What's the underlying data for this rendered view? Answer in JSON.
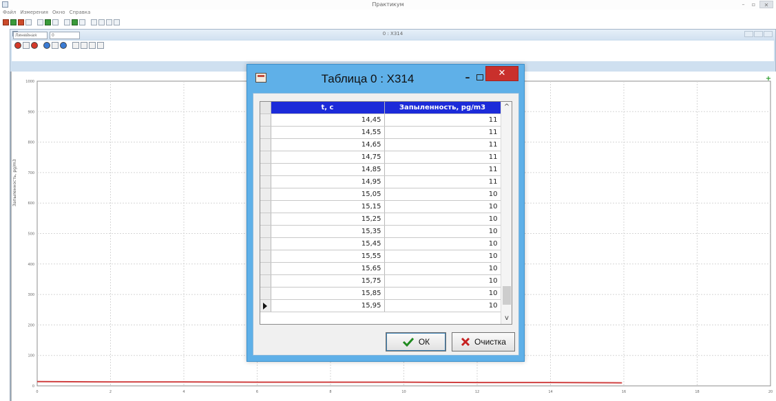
{
  "app": {
    "title": "Практикум",
    "menu": [
      "Файл",
      "Измерения",
      "Окно",
      "Справка"
    ],
    "window_controls": [
      "–",
      "▫",
      "✕"
    ]
  },
  "child_window": {
    "title": "0 : X314",
    "series_select_value": "Линейная",
    "series_input_value": "0"
  },
  "chart": {
    "ylabel": "Запыленность, pg/m3",
    "add_button": "+"
  },
  "chart_data": {
    "type": "line",
    "title": "",
    "xlabel": "",
    "ylabel": "Запыленность, pg/m3",
    "ylim": [
      0,
      1000
    ],
    "xlim": [
      0,
      20
    ],
    "y_ticks": [
      "0",
      "100",
      "200",
      "300",
      "400",
      "500",
      "600",
      "700",
      "800",
      "900",
      "1000"
    ],
    "x_ticks": [
      "0",
      "2",
      "4",
      "6",
      "8",
      "10",
      "12",
      "14",
      "16",
      "18",
      "20"
    ],
    "grid": true,
    "series": [
      {
        "x": [
          0,
          2,
          4,
          6,
          8,
          10,
          12,
          14,
          15.95
        ],
        "values": [
          14,
          13,
          13,
          12,
          12,
          12,
          11,
          11,
          10
        ],
        "color": "#d04040"
      }
    ]
  },
  "dialog": {
    "title": "Таблица 0 : X314",
    "columns": [
      "t, c",
      "Запыленность, pg/m3"
    ],
    "rows": [
      [
        "14,45",
        "11"
      ],
      [
        "14,55",
        "11"
      ],
      [
        "14,65",
        "11"
      ],
      [
        "14,75",
        "11"
      ],
      [
        "14,85",
        "11"
      ],
      [
        "14,95",
        "11"
      ],
      [
        "15,05",
        "10"
      ],
      [
        "15,15",
        "10"
      ],
      [
        "15,25",
        "10"
      ],
      [
        "15,35",
        "10"
      ],
      [
        "15,45",
        "10"
      ],
      [
        "15,55",
        "10"
      ],
      [
        "15,65",
        "10"
      ],
      [
        "15,75",
        "10"
      ],
      [
        "15,85",
        "10"
      ],
      [
        "15,95",
        "10"
      ]
    ],
    "current_row_index": 15,
    "ok_label": "ОК",
    "clear_label": "Очистка",
    "close_label": "✕",
    "min_label": "–",
    "accent_color": "#1c2bd9"
  }
}
